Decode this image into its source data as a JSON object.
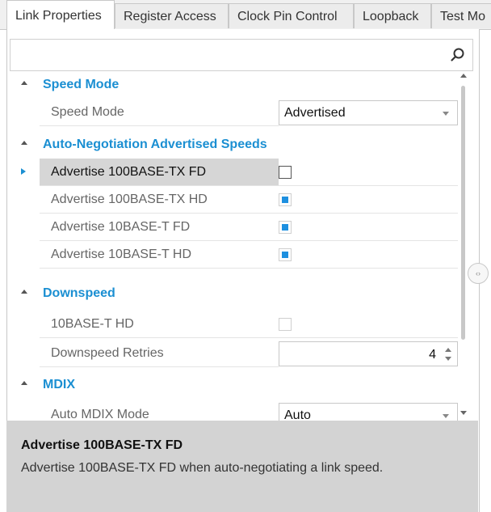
{
  "tabs": [
    {
      "label": "Link Properties",
      "active": true
    },
    {
      "label": "Register Access",
      "active": false
    },
    {
      "label": "Clock Pin Control",
      "active": false
    },
    {
      "label": "Loopback",
      "active": false
    },
    {
      "label": "Test Mo",
      "active": false
    }
  ],
  "search": {
    "placeholder": "",
    "value": ""
  },
  "categories": {
    "speed_mode": {
      "label": "Speed Mode",
      "speed_mode": {
        "label": "Speed Mode",
        "value": "Advertised"
      }
    },
    "auto_neg": {
      "label": "Auto-Negotiation Advertised Speeds",
      "items": [
        {
          "label": "Advertise 100BASE-TX FD",
          "checked": false,
          "selected": true
        },
        {
          "label": "Advertise 100BASE-TX HD",
          "checked": true
        },
        {
          "label": "Advertise 10BASE-T FD",
          "checked": true
        },
        {
          "label": "Advertise 10BASE-T HD",
          "checked": true
        }
      ]
    },
    "downspeed": {
      "label": "Downspeed",
      "hd": {
        "label": "10BASE-T HD",
        "checked": false,
        "enabled": false
      },
      "retries": {
        "label": "Downspeed Retries",
        "value": "4"
      }
    },
    "mdix": {
      "label": "MDIX",
      "auto_mdix": {
        "label": "Auto MDIX Mode",
        "value": "Auto"
      }
    }
  },
  "description": {
    "title": "Advertise 100BASE-TX FD",
    "text": "Advertise 100BASE-TX FD when auto-negotiating a link speed."
  },
  "colors": {
    "category": "#1b8fd2",
    "checkbox": "#1e90e0",
    "description_bg": "#d3d3d3"
  },
  "icons": {
    "search": "search-icon",
    "splitter": "splitter-handle-icon"
  }
}
